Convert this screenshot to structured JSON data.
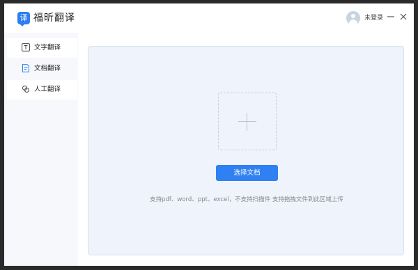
{
  "app": {
    "logo_glyph": "译",
    "name": "福昕翻译",
    "accent_color": "#2e7ff0"
  },
  "header": {
    "login_text": "未登录",
    "minimize_icon": "minimize-icon",
    "close_icon": "close-icon"
  },
  "sidebar": {
    "items": [
      {
        "label": "文字翻译",
        "icon": "text-icon",
        "active": false
      },
      {
        "label": "文档翻译",
        "icon": "document-icon",
        "active": true
      },
      {
        "label": "人工翻译",
        "icon": "human-icon",
        "active": false
      }
    ]
  },
  "main": {
    "upload_icon": "plus-icon",
    "select_button_label": "选择文档",
    "hint_text": "支持pdf、word、ppt、excel，不支持扫描件 支持拖拽文件到此区域上传"
  }
}
